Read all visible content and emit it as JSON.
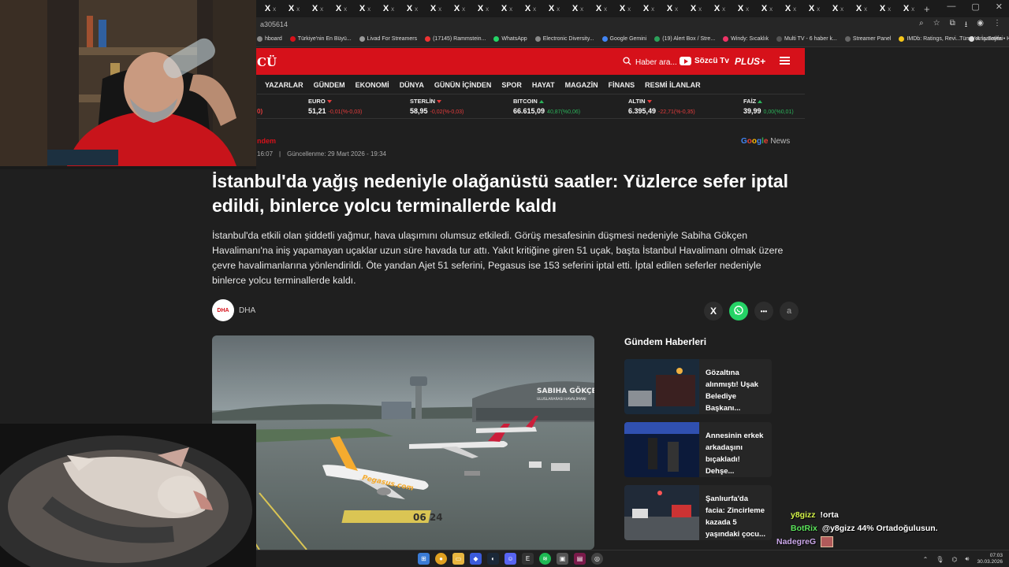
{
  "browser": {
    "tab_label": "x",
    "tab_count": 28,
    "url_fragment": "a305614",
    "bookmarks": [
      "hboard",
      "Türkiye'nin En Büyü...",
      "Livad For Streamers",
      "(17145) Rammstein...",
      "WhatsApp",
      "Electronic Diversity...",
      "Google Gemini",
      "(19) Alert Box / Stre...",
      "Windy: Sıcaklık",
      "Multi TV - 6 haber k...",
      "Streamer Panel",
      "IMDb: Ratings, Revi...",
      "Ana Sayfa • HBO Max"
    ],
    "bookmarks_more": "»",
    "bookmarks_right": "Tüm Yer İşaretleri"
  },
  "site": {
    "logo_partial": "CÜ",
    "search_placeholder": "Haber ara...",
    "tv_label": "Sözcü Tv",
    "plus_label": "PLUS+",
    "nav": [
      "YAZARLAR",
      "GÜNDEM",
      "EKONOMİ",
      "DÜNYA",
      "GÜNÜN İÇİNDEN",
      "SPOR",
      "HAYAT",
      "MAGAZİN",
      "FİNANS",
      "RESMİ İLANLAR"
    ]
  },
  "tickers": {
    "partial": "0)",
    "items": [
      {
        "name": "EURO",
        "dir": "down",
        "value": "51,21",
        "change": "-0,01(%-0,03)"
      },
      {
        "name": "STERLİN",
        "dir": "down",
        "value": "58,95",
        "change": "-0,02(%-0,03)"
      },
      {
        "name": "BITCOIN",
        "dir": "up",
        "value": "66.615,09",
        "change": "40,87(%0,06)"
      },
      {
        "name": "ALTIN",
        "dir": "down",
        "value": "6.395,49",
        "change": "-22,71(%-0,35)"
      },
      {
        "name": "FAİZ",
        "dir": "up",
        "value": "39,99",
        "change": "0,00(%0,01)"
      }
    ]
  },
  "article": {
    "category": "ndem",
    "published": "16:07",
    "separator": "|",
    "updated": "Güncellenme: 29 Mart 2026 - 19:34",
    "google_news_word1": "Google",
    "google_news_word2": "News",
    "title": "İstanbul'da yağış nedeniyle olağanüstü saatler: Yüzlerce sefer iptal edildi, binlerce yolcu terminallerde kaldı",
    "summary": "İstanbul'da etkili olan şiddetli yağmur, hava ulaşımını olumsuz etkiledi. Görüş mesafesinin düşmesi nedeniyle Sabiha Gökçen Havalimanı'na iniş yapamayan uçaklar uzun süre havada tur attı. Yakıt kritiğine giren 51 uçak, başta İstanbul Havalimanı olmak üzere çevre havalimanlarına yönlendirildi. Öte yandan Ajet 51 seferini, Pegasus ise 153 seferini iptal etti. İptal edilen seferler nedeniyle binlerce yolcu terminallerde kaldı.",
    "source_logo": "DHA",
    "source_name": "DHA",
    "share_x": "X",
    "share_more": "•••",
    "font_size": "a",
    "image_sign_1": "SABIHA GÖKÇEN",
    "image_sign_2": "ULUSLARARASI HAVALİMANI",
    "image_plane_text": "Pegasus.com"
  },
  "sidebar": {
    "title": "Gündem Haberleri",
    "items": [
      {
        "text": "Gözaltına alınmıştı! Uşak Belediye Başkanı..."
      },
      {
        "text": "Annesinin erkek arkadaşını bıçakladı! Dehşe..."
      },
      {
        "text": "Şanlıurfa'da facia: Zincirleme kazada 5 yaşındaki çocu..."
      }
    ]
  },
  "chat": [
    {
      "user": "y8gizz",
      "message": "!orta"
    },
    {
      "user": "BotRix",
      "message": "@y8gizz 44% Ortadoğulusun."
    },
    {
      "user": "NadegreG",
      "message": ""
    }
  ],
  "taskbar": {
    "time": "07:03",
    "date": "30.03.2026"
  },
  "colors": {
    "brand_red": "#d6111a",
    "up": "#2bb35a",
    "down": "#e53b3b"
  }
}
